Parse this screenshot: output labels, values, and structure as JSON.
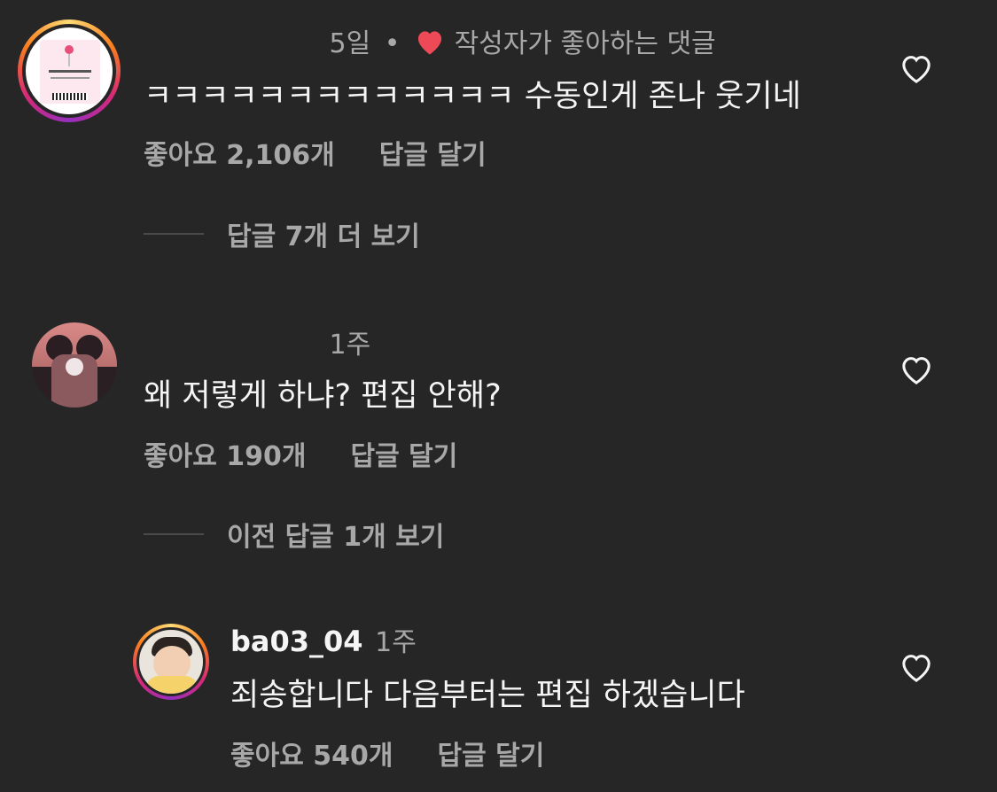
{
  "comments": [
    {
      "time": "5일",
      "separator": "•",
      "creator_liked_label": "작성자가 좋아하는 댓글",
      "text": "ㅋㅋㅋㅋㅋㅋㅋㅋㅋㅋㅋㅋㅋ 수동인게 존나 웃기네",
      "likes_label": "좋아요 2,106개",
      "reply_label": "답글 달기",
      "view_replies_label": "답글 7개 더 보기"
    },
    {
      "time": "1주",
      "text": "왜 저렇게 하냐? 편집 안해?",
      "likes_label": "좋아요 190개",
      "reply_label": "답글 달기",
      "view_replies_label": "이전 답글 1개 보기"
    },
    {
      "username": "ba03_04",
      "time": "1주",
      "text": "죄송합니다 다음부터는 편집 하겠습니다",
      "likes_label": "좋아요 540개",
      "reply_label": "답글 달기"
    }
  ],
  "colors": {
    "background": "#262626",
    "secondary_text": "#a8a8a8",
    "creator_heart": "#ed4956"
  },
  "icons": {
    "like": "heart-outline-icon",
    "creator_like": "heart-filled-icon"
  }
}
